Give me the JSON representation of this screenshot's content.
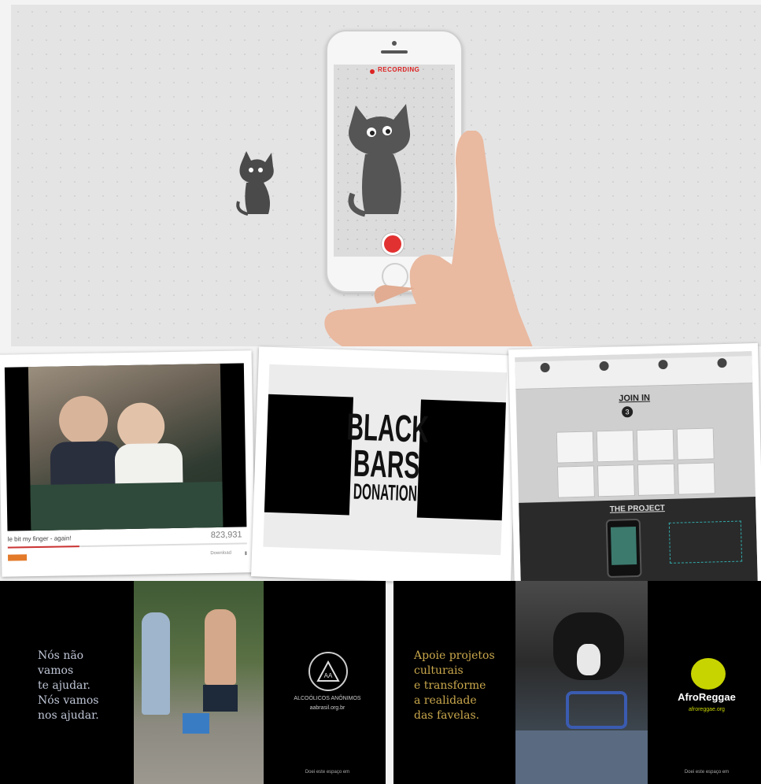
{
  "hero": {
    "record_label": "RECORDING"
  },
  "video": {
    "views": "823,931",
    "title": "le bit my finger - again!",
    "meta_left": "Download",
    "meta_right": "Comment"
  },
  "blackbars": {
    "line1": "BLACK",
    "line2": "BARS",
    "line3": "DONATION"
  },
  "website": {
    "join": "JOIN IN",
    "step": "3",
    "project": "THE PROJECT"
  },
  "panel_aa": {
    "text": "Nós não\nvamos\nte ajudar.\nNós vamos\nnos ajudar.",
    "org": "ALCOÓLICOS ANÔNIMOS",
    "url": "aabrasil.org.br",
    "footer": "Doei este espaço em"
  },
  "panel_afro": {
    "text": "Apoie projetos\nculturais\ne transforme\na realidade\ndas favelas.",
    "org": "AfroReggae",
    "url": "afroreggae.org",
    "footer": "Doei este espaço em"
  },
  "colors": {
    "record": "#d22222",
    "gold": "#c9a74c",
    "afro": "#c8d400"
  }
}
